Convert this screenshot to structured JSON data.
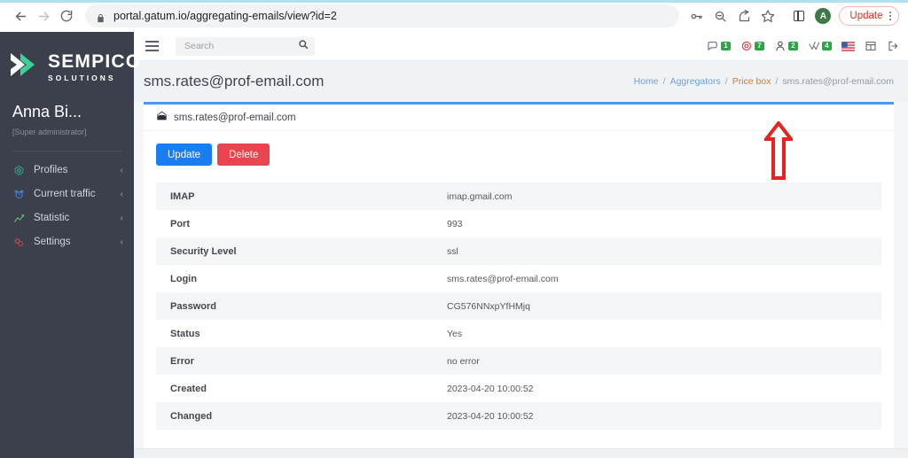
{
  "browser": {
    "back_label": "←",
    "forward_label": "→",
    "reload_label": "⟳",
    "lock_icon": "lock-icon",
    "url": "portal.gatum.io/aggregating-emails/view?id=2",
    "actions": {
      "password_key_icon": "key-icon",
      "zoom_out_icon": "zoom-out-icon",
      "share_icon": "share-icon",
      "bookmark_icon": "star-icon",
      "side_panel_icon": "side-panel-icon",
      "profile_initial": "A",
      "update_label": "Update",
      "menu_icon": "kebab-menu-icon"
    }
  },
  "sidebar": {
    "logo": {
      "title": "SEMPICO",
      "subtitle": "SOLUTIONS",
      "mark_icon": "chevron-logo-icon"
    },
    "user": {
      "name": "Anna Bi...",
      "role": "[Super administrator]"
    },
    "items": [
      {
        "label": "Profiles",
        "icon": "profiles-icon",
        "chevron": "‹"
      },
      {
        "label": "Current traffic",
        "icon": "traffic-icon",
        "chevron": "‹"
      },
      {
        "label": "Statistic",
        "icon": "statistic-icon",
        "chevron": "‹"
      },
      {
        "label": "Settings",
        "icon": "settings-icon",
        "chevron": "‹"
      }
    ]
  },
  "topbar": {
    "menu_toggle_icon": "hamburger-icon",
    "search": {
      "placeholder": "Search",
      "value": "",
      "icon": "search-icon"
    },
    "icons": [
      {
        "name": "chat-icon",
        "badge": "1"
      },
      {
        "name": "alert-icon",
        "badge": "7"
      },
      {
        "name": "user-icon",
        "badge": "2"
      },
      {
        "name": "check-icon",
        "badge": "4"
      },
      {
        "name": "flag-us-icon",
        "badge": ""
      },
      {
        "name": "grid-icon",
        "badge": ""
      },
      {
        "name": "logout-icon",
        "badge": ""
      }
    ]
  },
  "page": {
    "title": "sms.rates@prof-email.com",
    "breadcrumb": [
      {
        "label": "Home",
        "type": "link"
      },
      {
        "label": "Aggregators",
        "type": "link"
      },
      {
        "label": "Price box",
        "type": "link-active"
      },
      {
        "label": "sms.rates@prof-email.com",
        "type": "current"
      }
    ]
  },
  "card": {
    "header_icon": "envelope-icon",
    "header_title": "sms.rates@prof-email.com",
    "buttons": [
      {
        "label": "Update",
        "style": "primary"
      },
      {
        "label": "Delete",
        "style": "danger"
      }
    ],
    "rows": [
      {
        "label": "IMAP",
        "value": "imap.gmail.com"
      },
      {
        "label": "Port",
        "value": "993"
      },
      {
        "label": "Security Level",
        "value": "ssl"
      },
      {
        "label": "Login",
        "value": "sms.rates@prof-email.com"
      },
      {
        "label": "Password",
        "value": "CG576NNxpYfHMjq"
      },
      {
        "label": "Status",
        "value": "Yes"
      },
      {
        "label": "Error",
        "value": "no error"
      },
      {
        "label": "Created",
        "value": "2023-04-20 10:00:52"
      },
      {
        "label": "Changed",
        "value": "2023-04-20 10:00:52"
      }
    ]
  },
  "annotation": {
    "arrow_icon": "red-up-arrow-icon",
    "color": "#e52420"
  },
  "colors": {
    "sidebar_bg": "#3b404c",
    "card_accent": "#4f97e6",
    "primary_button": "#1a7ef2",
    "danger_button": "#e8454f",
    "badge_green": "#28a745",
    "breadcrumb_link": "#6c9fd8",
    "breadcrumb_active": "#d4792e"
  }
}
